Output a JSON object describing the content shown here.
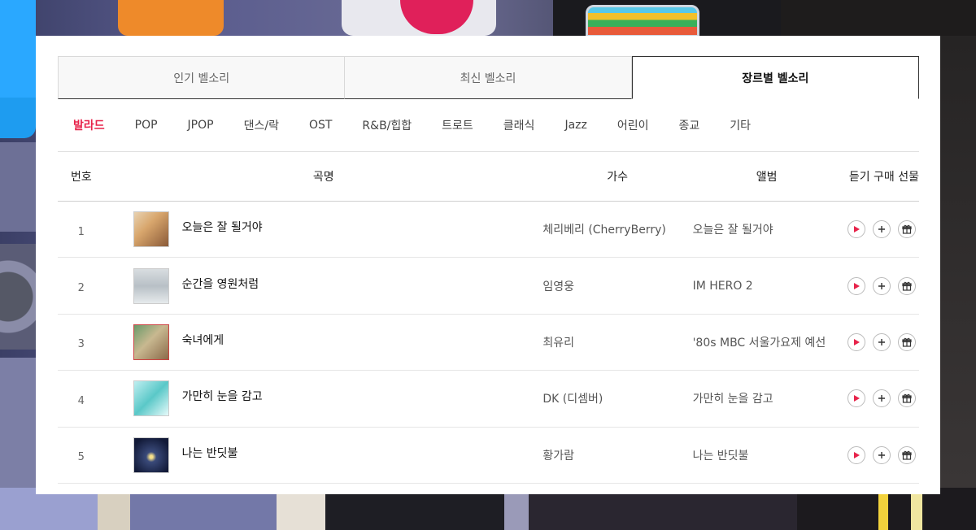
{
  "tabs": [
    {
      "label": "인기 벨소리",
      "active": false
    },
    {
      "label": "최신 벨소리",
      "active": false
    },
    {
      "label": "장르별 벨소리",
      "active": true
    }
  ],
  "genres": [
    "발라드",
    "POP",
    "JPOP",
    "댄스/락",
    "OST",
    "R&B/힙합",
    "트로트",
    "클래식",
    "Jazz",
    "어린이",
    "종교",
    "기타"
  ],
  "active_genre": "발라드",
  "table": {
    "headers": {
      "num": "번호",
      "title": "곡명",
      "artist": "가수",
      "album": "앨범",
      "actions": "듣기 구매 선물"
    },
    "rows": [
      {
        "num": "1",
        "title": "오늘은 잘 될거야",
        "artist": "체리베리 (CherryBerry)",
        "album": "오늘은 잘 될거야"
      },
      {
        "num": "2",
        "title": "순간을 영원처럼",
        "artist": "임영웅",
        "album": "IM HERO 2"
      },
      {
        "num": "3",
        "title": "숙녀에게",
        "artist": "최유리",
        "album": "'80s MBC 서울가요제 예선"
      },
      {
        "num": "4",
        "title": "가만히 눈을 감고",
        "artist": "DK (디셈버)",
        "album": "가만히 눈을 감고"
      },
      {
        "num": "5",
        "title": "나는 반딧불",
        "artist": "황가람",
        "album": "나는 반딧불"
      }
    ]
  },
  "colors": {
    "accent": "#e7234a",
    "play_icon": "#e7234a"
  },
  "icons": {
    "listen": "play-icon",
    "buy": "plus-icon",
    "gift": "gift-icon"
  }
}
